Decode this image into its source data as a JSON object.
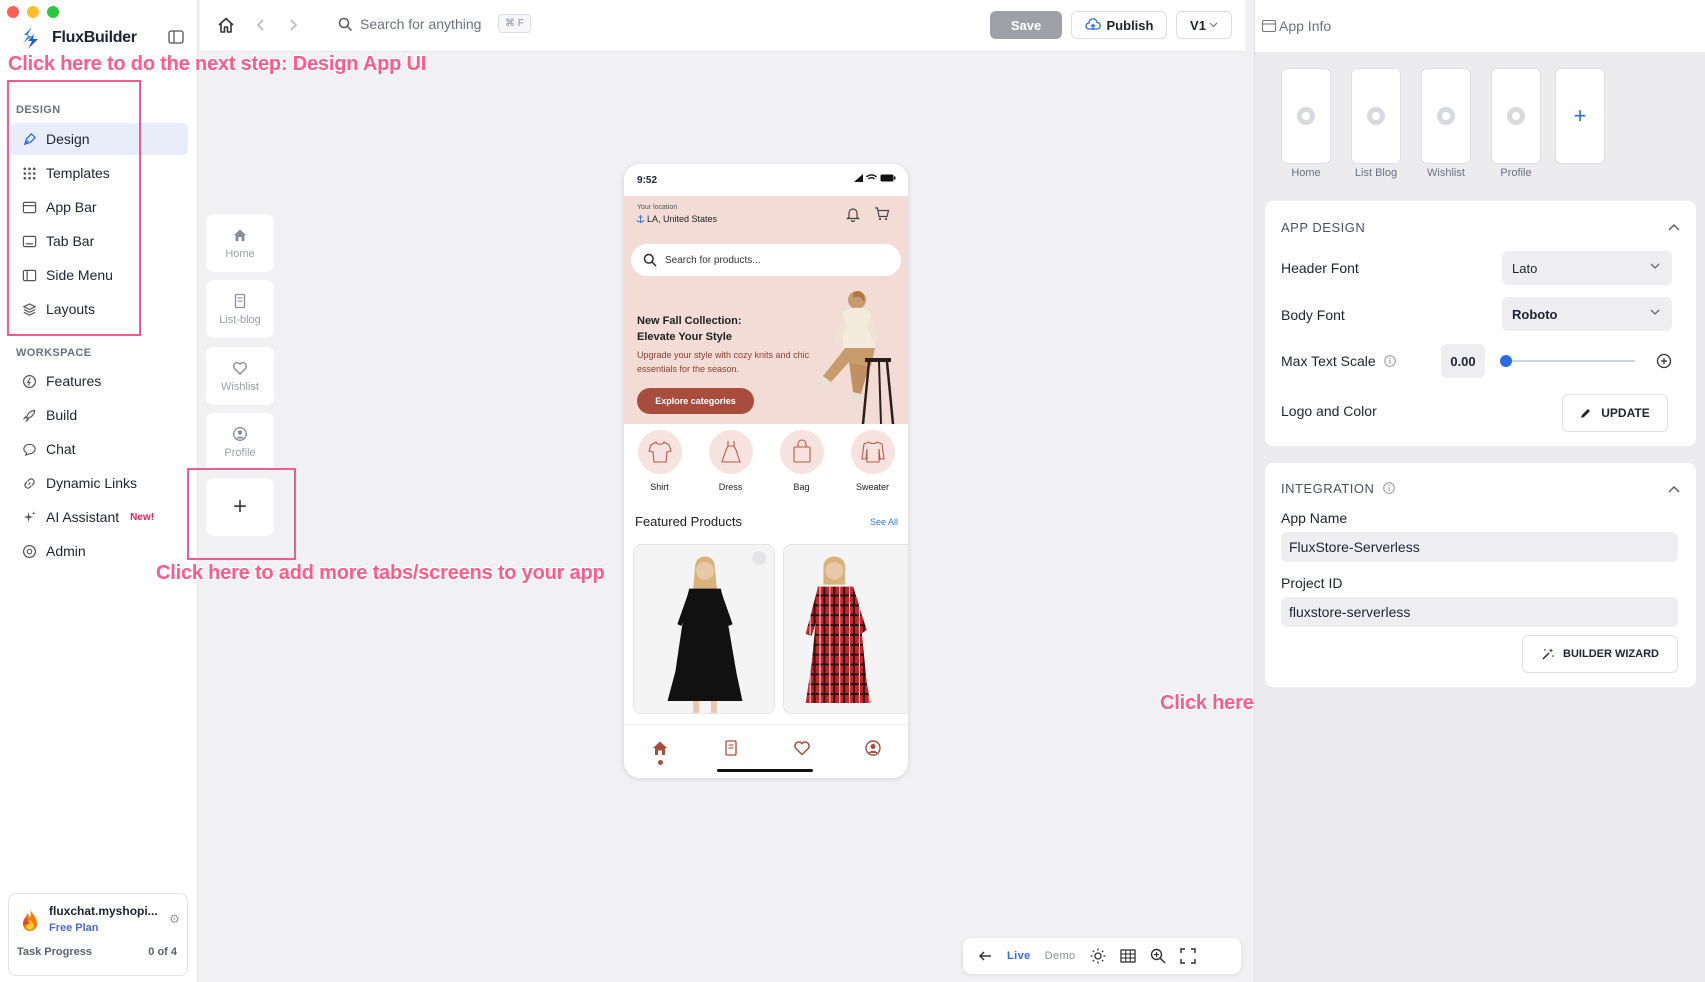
{
  "app": {
    "brand": "FluxBuilder"
  },
  "sidebar": {
    "design_label": "DESIGN",
    "design_items": [
      {
        "label": "Design",
        "icon": "pen-tool-icon",
        "active": true
      },
      {
        "label": "Templates",
        "icon": "grid-dots-icon"
      },
      {
        "label": "App Bar",
        "icon": "app-bar-icon"
      },
      {
        "label": "Tab Bar",
        "icon": "tab-bar-icon"
      },
      {
        "label": "Side Menu",
        "icon": "side-menu-icon"
      },
      {
        "label": "Layouts",
        "icon": "layers-icon"
      }
    ],
    "workspace_label": "WORKSPACE",
    "workspace_items": [
      {
        "label": "Features",
        "icon": "bolt-icon"
      },
      {
        "label": "Build",
        "icon": "rocket-icon"
      },
      {
        "label": "Chat",
        "icon": "chat-icon"
      },
      {
        "label": "Dynamic Links",
        "icon": "link-icon"
      },
      {
        "label": "AI Assistant",
        "icon": "sparkle-icon",
        "badge": "New!"
      },
      {
        "label": "Admin",
        "icon": "admin-icon"
      }
    ],
    "store": {
      "name": "fluxchat.myshopi...",
      "plan": "Free Plan",
      "task_label": "Task Progress",
      "task_count": "0 of 4"
    }
  },
  "toolbar": {
    "search_placeholder": "Search for anything",
    "shortcut": "⌘ F",
    "save_label": "Save",
    "publish_label": "Publish",
    "version_label": "V1"
  },
  "tabs": [
    {
      "label": "Home",
      "icon": "home-icon"
    },
    {
      "label": "List-blog",
      "icon": "document-icon"
    },
    {
      "label": "Wishlist",
      "icon": "heart-icon"
    },
    {
      "label": "Profile",
      "icon": "user-icon"
    }
  ],
  "annotations": {
    "next_step": "Click here to do the next step: Design App UI",
    "add_tabs": "Click here to add more tabs/screens to your app",
    "edit_firebase": "Click here to edit your firebase, app name, logo, color"
  },
  "phone": {
    "time": "9:52",
    "location_label": "Your location",
    "location": "LA, United States",
    "search_placeholder": "Search for products...",
    "banner_title_1": "New Fall Collection:",
    "banner_title_2": "Elevate Your Style",
    "banner_sub": "Upgrade your style with cozy knits and chic essentials for the season.",
    "banner_button": "Explore categories",
    "categories": [
      "Shirt",
      "Dress",
      "Bag",
      "Sweater"
    ],
    "featured_title": "Featured Products",
    "see_all": "See All"
  },
  "bottom_tools": {
    "live": "Live",
    "demo": "Demo"
  },
  "right_panel": {
    "title": "App Info",
    "screens": [
      "Home",
      "List Blog",
      "Wishlist",
      "Profile"
    ],
    "app_design": {
      "title": "APP DESIGN",
      "header_font_label": "Header Font",
      "header_font": "Lato",
      "body_font_label": "Body Font",
      "body_font": "Roboto",
      "max_text_scale_label": "Max Text Scale",
      "max_text_scale": "0.00",
      "logo_color_label": "Logo and Color",
      "update_label": "UPDATE"
    },
    "integration": {
      "title": "INTEGRATION",
      "app_name_label": "App Name",
      "app_name": "FluxStore-Serverless",
      "project_id_label": "Project ID",
      "project_id": "fluxstore-serverless",
      "wizard_label": "BUILDER WIZARD"
    }
  },
  "colors": {
    "accent": "#2b6be3",
    "annotation": "#ff5a8c",
    "brand_primary": "#a84d3d"
  }
}
